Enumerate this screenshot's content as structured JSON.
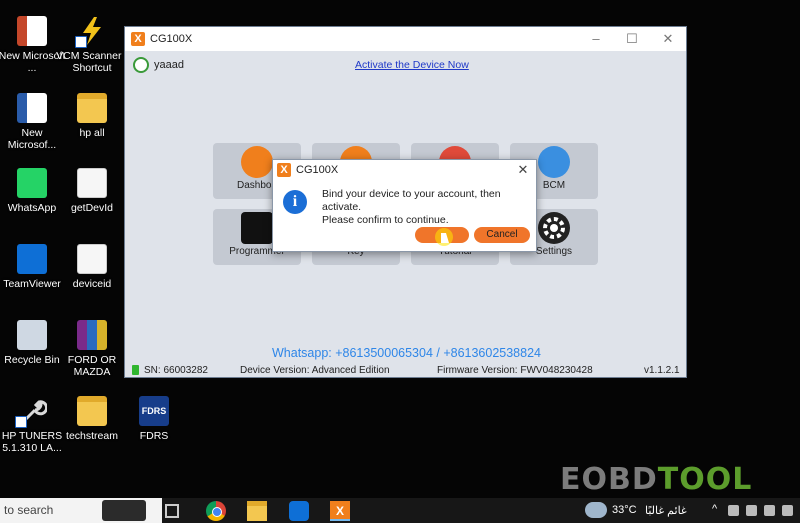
{
  "desktop": {
    "icons": [
      {
        "label": "New Microsoft ...",
        "icon": "powerpoint-icon"
      },
      {
        "label": "VCM Scanner - Shortcut",
        "icon": "vcm-scanner-icon"
      },
      {
        "label": "New Microsof...",
        "icon": "word-icon"
      },
      {
        "label": "hp all",
        "icon": "folder-icon"
      },
      {
        "label": "WhatsApp",
        "icon": "whatsapp-icon"
      },
      {
        "label": "getDevId",
        "icon": "getdevid-icon"
      },
      {
        "label": "TeamViewer",
        "icon": "teamviewer-icon"
      },
      {
        "label": "deviceid",
        "icon": "text-file-icon"
      },
      {
        "label": "Recycle Bin",
        "icon": "recycle-bin-icon"
      },
      {
        "label": "FORD OR MAZDA",
        "icon": "winrar-icon"
      },
      {
        "label": "HP TUNERS 5.1.310 LA...",
        "icon": "hp-tuners-icon"
      },
      {
        "label": "techstream",
        "icon": "folder-icon"
      },
      {
        "label": "FDRS",
        "icon": "fdrs-icon"
      }
    ],
    "fdrs_icon_text": "FDRS"
  },
  "app": {
    "title": "CG100X",
    "logo_letter": "X",
    "username": "yaaad",
    "activate_link": "Activate the Device Now",
    "tiles": [
      {
        "label": "Dashboa",
        "icon": "speedometer-icon",
        "color": "#f07f1c"
      },
      {
        "label": "",
        "icon": "users-icon",
        "color": "#f07f1c"
      },
      {
        "label": "",
        "icon": "key-fob-icon",
        "color": "#e04a3a"
      },
      {
        "label": "BCM",
        "icon": "bcm-icon",
        "color": "#3a8fe0"
      },
      {
        "label": "Programmer",
        "icon": "chip-icon",
        "color": "#111111"
      },
      {
        "label": "Key",
        "icon": "key-icon",
        "color": "#f07f1c"
      },
      {
        "label": "Tutorial",
        "icon": "tutorial-icon",
        "color": "#e04a3a"
      },
      {
        "label": "Settings",
        "icon": "gear-icon",
        "color": "#222222"
      }
    ],
    "contact": "Whatsapp: +8613500065304 / +8613602538824",
    "status": {
      "sn": "SN: 66003282",
      "device_version": "Device Version: Advanced Edition",
      "firmware_version": "Firmware Version: FWV048230428",
      "app_version": "v1.1.2.1"
    }
  },
  "dialog": {
    "title": "CG100X",
    "message_line1": "Bind your device to your account, then activate.",
    "message_line2": "Please confirm to continue.",
    "ok_label": "",
    "cancel_label": "Cancel"
  },
  "watermark": {
    "left": "EOBD",
    "right": "TOOL"
  },
  "taskbar": {
    "search_placeholder": "to search",
    "temperature": "33°C",
    "weather": "غائم غالبًا",
    "tray_chevron": "^"
  },
  "colors": {
    "brand_orange": "#f07f1c",
    "contact_blue": "#2e86e8",
    "link_blue": "#1f39c8"
  }
}
